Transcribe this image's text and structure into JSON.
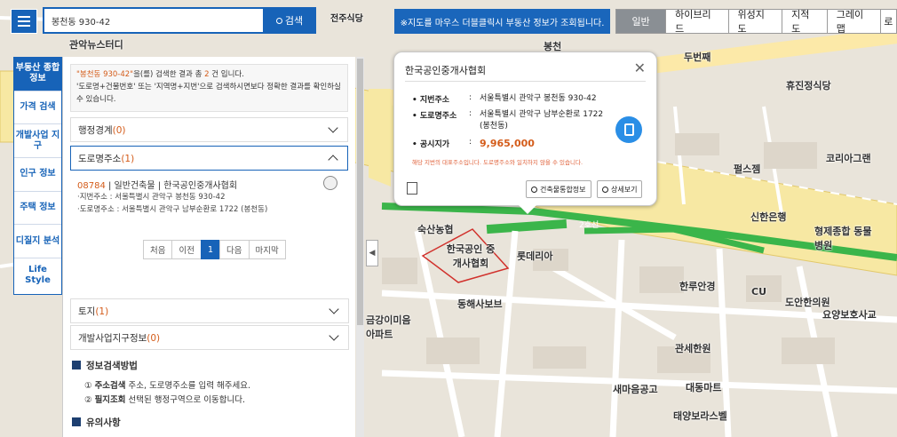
{
  "header": {
    "search_value": "봉천동 930-42",
    "search_button": "검색",
    "notice": "※지도를 마우스 더블클릭시 부동산 정보가 조회됩니다.",
    "map_types": [
      "일반",
      "하이브리드",
      "위성지도",
      "지적도",
      "그레이맵",
      "로"
    ]
  },
  "left_tabs": [
    {
      "label": "부동산 종합정보",
      "active": true
    },
    {
      "label": "가격 검색"
    },
    {
      "label": "개발사업 지구"
    },
    {
      "label": "인구 정보"
    },
    {
      "label": "주택 정보"
    },
    {
      "label": "디질지 분석"
    },
    {
      "label": "Life Style"
    }
  ],
  "results": {
    "query": "\"봉천동 930-42\"",
    "msg1": "을(를) 검색한 결과 총 ",
    "count": "2",
    "msg2": " 건 입니다.",
    "msg3": "'도로명+건물번호' 또는 '지역명+지번'으로 검색하시면보다 정확한 결과를 확인하실 수 있습니다.",
    "section_admin": "행정경계",
    "section_admin_count": "(0)",
    "section_road": "도로명주소",
    "section_road_count": "(1)",
    "address": {
      "zip": "08784",
      "line1": " | 일반건축물 | 한국공인중개사협회",
      "jibun": "·지번주소 : 서울특별시 관악구 봉천동 930-42",
      "road": "·도로명주소 : 서울특별시 관악구 남부순환로 1722 (봉천동)"
    },
    "pager": [
      "처음",
      "이전",
      "1",
      "다음",
      "마지막"
    ],
    "section_land": "토지",
    "section_land_count": "(1)",
    "section_dev": "개발사업지구정보",
    "section_dev_count": "(0)",
    "info_title": "정보검색방법",
    "info_step1_num": "①",
    "info_step1_bold": "주소검색",
    "info_step1_text": " 주소, 도로명주소를 입력 해주세요.",
    "info_step2_num": "②",
    "info_step2_bold": "필지조회",
    "info_step2_text": " 선택된 행정구역으로 이동합니다.",
    "notes_title": "유의사항"
  },
  "popup": {
    "title": "한국공인중개사협회",
    "jibun_label": "지번주소",
    "jibun_value": "서울특별시 관악구 봉천동 930-42",
    "road_label": "도로명주소",
    "road_value": "서울특별시 관악구 남부순환로 1722 (봉천동)",
    "price_label": "공시지가",
    "price_value": "9,965,000",
    "warning": "해당 지번의 대표주소입니다. 도로명주소와 일치하지 않을 수 있습니다.",
    "btn_building": "건축물통합정보",
    "btn_detail": "상세보기"
  },
  "map_labels": {
    "l1": "전주식당",
    "l2": "관악뉴스터디",
    "l3": "봉천",
    "l4": "두번째",
    "l5": "휴진정식당",
    "l6": "펄스젬",
    "l7": "신한은행",
    "l8": "형제종합 동물병원",
    "l9": "숙산농협",
    "l10": "한국공인 중개사협회",
    "l11": "롯데리아",
    "l12": "동해사보브",
    "l13": "금강이미음 아파트",
    "l14": "한루안경",
    "l15": "요양보호사교",
    "l16": "관세한원",
    "l17": "대동마트",
    "l18": "새마음공고",
    "l19": "태양보라스벨",
    "l20": "도안한의원",
    "l21": "2호선",
    "l22": "CU",
    "l23": "코리아그랜"
  }
}
